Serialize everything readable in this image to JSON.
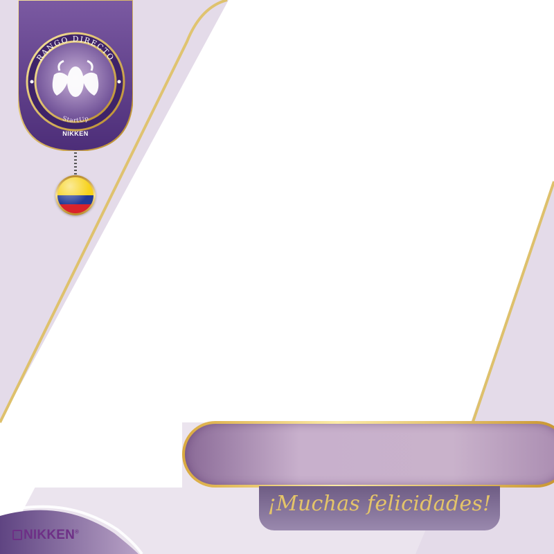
{
  "badge": {
    "arc_top": "RANGO DIRECTO",
    "arc_bottom": "StartUp",
    "brand": "NIKKEN"
  },
  "flag": {
    "country": "Colombia",
    "colors": [
      "#f7d21a",
      "#233a95",
      "#d9232a"
    ]
  },
  "message": {
    "congrats": "¡Muchas felicidades!"
  },
  "footer": {
    "brand": "NIKKEN",
    "registered": "®"
  },
  "colors": {
    "purple": "#5b3a86",
    "gold": "#d9b452",
    "lavender": "#ebe4ee"
  }
}
